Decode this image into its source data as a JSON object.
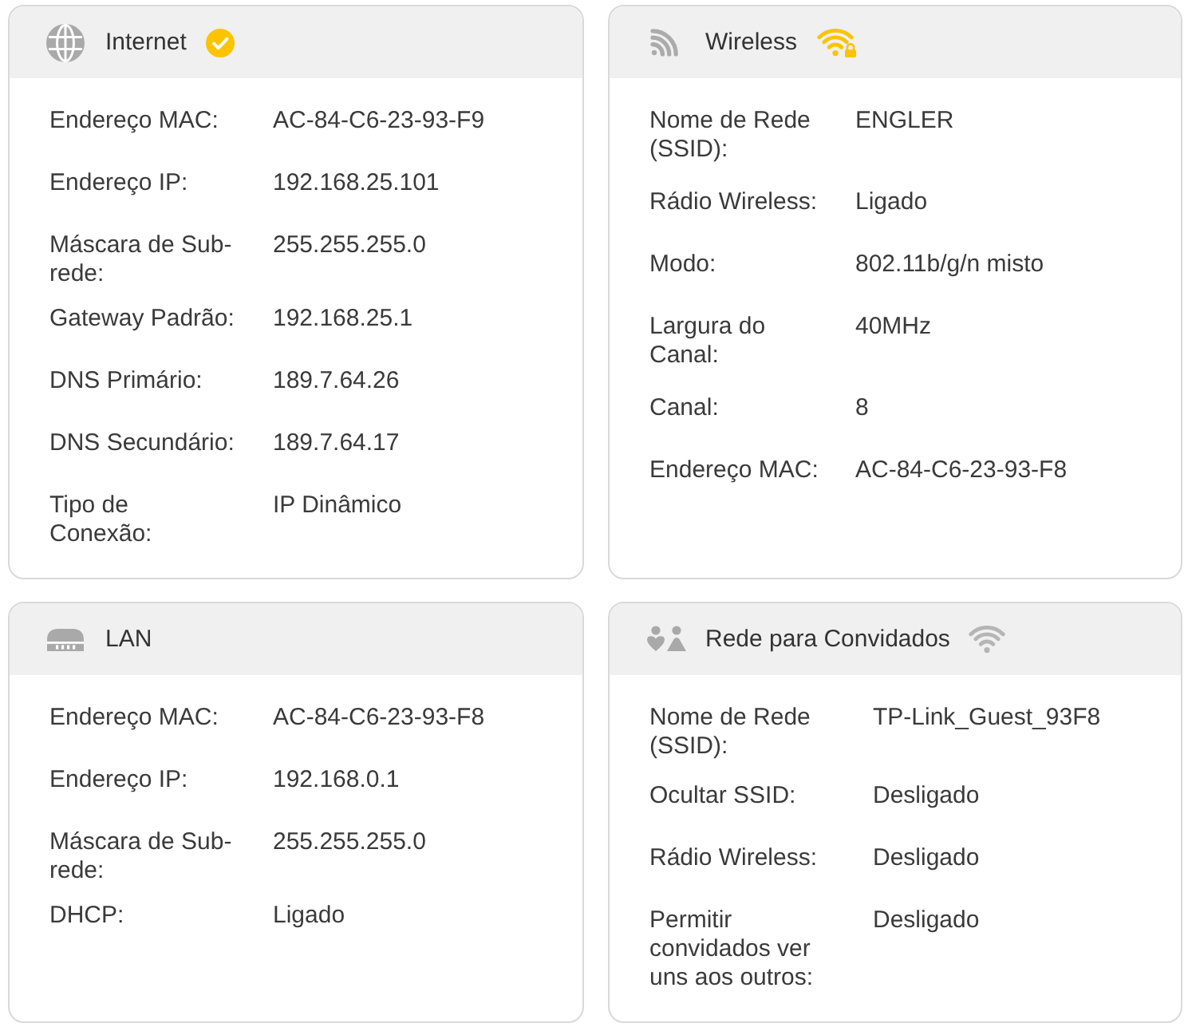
{
  "cards": [
    {
      "kind": "internet",
      "title": "Internet",
      "on": true,
      "rows": [
        {
          "label": "Endereço MAC:",
          "value": "AC-84-C6-23-93-F9"
        },
        {
          "label": "Endereço IP:",
          "value": "192.168.25.101"
        },
        {
          "label": "Máscara de Sub-rede:",
          "value": "255.255.255.0"
        },
        {
          "label": "Gateway Padrão:",
          "value": "192.168.25.1"
        },
        {
          "label": "DNS Primário:",
          "value": "189.7.64.26"
        },
        {
          "label": "DNS Secundário:",
          "value": "189.7.64.17"
        },
        {
          "label": "Tipo de Conexão:",
          "value": "IP Dinâmico"
        }
      ]
    },
    {
      "kind": "wireless",
      "title": "Wireless",
      "on": true,
      "secured": true,
      "rows": [
        {
          "label": "Nome de Rede (SSID):",
          "value": "ENGLER"
        },
        {
          "label": "Rádio Wireless:",
          "value": "Ligado"
        },
        {
          "label": "Modo:",
          "value": "802.11b/g/n misto"
        },
        {
          "label": "Largura do Canal:",
          "value": "40MHz"
        },
        {
          "label": "Canal:",
          "value": "8"
        },
        {
          "label": "Endereço MAC:",
          "value": "AC-84-C6-23-93-F8"
        }
      ]
    },
    {
      "kind": "lan",
      "title": "LAN",
      "rows": [
        {
          "label": "Endereço MAC:",
          "value": "AC-84-C6-23-93-F8"
        },
        {
          "label": "Endereço IP:",
          "value": "192.168.0.1"
        },
        {
          "label": "Máscara de Sub-rede:",
          "value": "255.255.255.0"
        },
        {
          "label": "DHCP:",
          "value": "Ligado"
        }
      ]
    },
    {
      "kind": "guest",
      "title": "Rede para Convidados",
      "on": false,
      "secured": false,
      "rows": [
        {
          "label": "Nome de Rede (SSID):",
          "value": "TP-Link_Guest_93F8"
        },
        {
          "label": "Ocultar SSID:",
          "value": "Desligado"
        },
        {
          "label": "Rádio Wireless:",
          "value": "Desligado"
        },
        {
          "label": "Permitir convidados ver uns aos outros:",
          "value": "Desligado"
        }
      ]
    }
  ]
}
